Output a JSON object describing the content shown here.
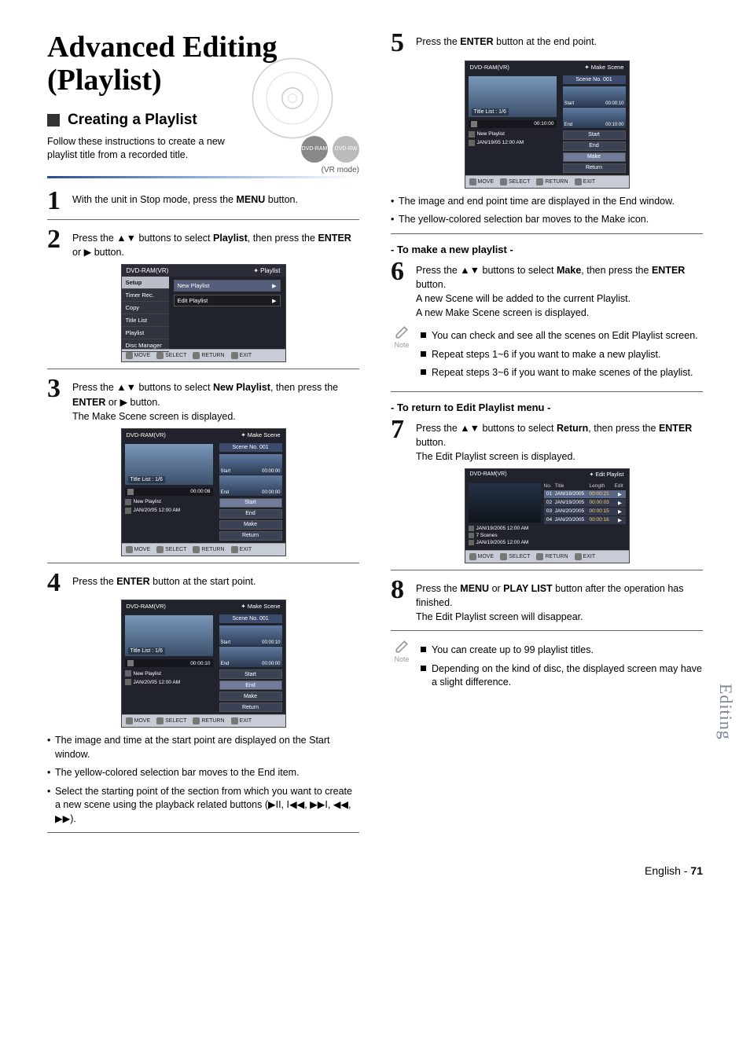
{
  "page": {
    "main_title_line1": "Advanced Editing",
    "main_title_line2": "(Playlist)",
    "section_title": "Creating a Playlist",
    "intro": "Follow these instructions to create a new playlist title from a recorded title.",
    "badge1": "DVD-RAM",
    "badge2": "DVD-RW",
    "vr_mode": "(VR mode)",
    "side_tab": "Editing",
    "footer_lang": "English",
    "footer_sep": " - ",
    "footer_page": "71"
  },
  "steps": {
    "s1": {
      "num": "1",
      "text_a": "With the unit in Stop mode, press the ",
      "text_b": "MENU",
      "text_c": " button."
    },
    "s2": {
      "num": "2",
      "a": "Press the ",
      "b": "▲▼",
      "c": " buttons to select ",
      "d": "Playlist",
      "e": ", then press the ",
      "f": "ENTER",
      "g": " or ",
      "h": "▶",
      "i": " button."
    },
    "s3": {
      "num": "3",
      "a": "Press the ",
      "b": "▲▼",
      "c": " buttons to select ",
      "d": "New Playlist",
      "e": ", then press the ",
      "f": "ENTER",
      "g": " or ",
      "h": "▶",
      "i": " button.",
      "sub": "The Make Scene screen is displayed."
    },
    "s4": {
      "num": "4",
      "a": "Press the ",
      "b": "ENTER",
      "c": " button at the start point."
    },
    "s4b": [
      "The image and time at the start point are displayed on the Start window.",
      "The yellow-colored selection bar moves to the End item.",
      "Select the starting point of the section from which you want to create a new scene using the playback related buttons (▶II, I◀◀, ▶▶I, ◀◀, ▶▶)."
    ],
    "s5": {
      "num": "5",
      "a": "Press the ",
      "b": "ENTER",
      "c": " button at the end point."
    },
    "s5b": [
      "The image and end point time are displayed in the End window.",
      "The yellow-colored selection bar moves to the Make icon."
    ],
    "s6": {
      "num": "6",
      "a": "Press the ",
      "b": "▲▼",
      "c": " buttons to select ",
      "d": "Make",
      "e": ", then press the ",
      "f": "ENTER",
      "g": " button.",
      "sub1": "A new Scene will be added to the current Playlist.",
      "sub2": "A new Make Scene screen is displayed."
    },
    "note1": [
      "You can check and see all the scenes on Edit Playlist screen.",
      "Repeat steps 1~6 if you want to make a new playlist.",
      "Repeat steps 3~6 if you want to make scenes of the playlist."
    ],
    "s7": {
      "num": "7",
      "a": "Press the ",
      "b": "▲▼",
      "c": " buttons to select ",
      "d": "Return",
      "e": ", then press the ",
      "f": "ENTER",
      "g": " button.",
      "sub": "The Edit Playlist screen is displayed."
    },
    "s8": {
      "num": "8",
      "a": "Press the ",
      "b": "MENU",
      "c": " or ",
      "d": "PLAY LIST",
      "e": " button after the operation has finished.",
      "sub": "The Edit Playlist screen will disappear."
    },
    "note2": [
      "You can create up to 99 playlist titles.",
      "Depending on the kind of disc, the displayed screen may have a slight difference."
    ],
    "sub_newpl": "- To make a new playlist -",
    "sub_return": "- To return to Edit Playlist menu -",
    "note_label": "Note"
  },
  "osd_menu": {
    "header_l": "DVD-RAM(VR)",
    "header_r": "Playlist",
    "side": [
      "Setup",
      "Timer Rec.",
      "Copy",
      "Title List",
      "Playlist",
      "Disc Manager"
    ],
    "opts": [
      "New Playlist",
      "Edit Playlist"
    ],
    "foot": {
      "move": "MOVE",
      "select": "SELECT",
      "return": "RETURN",
      "exit": "EXIT"
    }
  },
  "osd_scene": {
    "header_l": "DVD-RAM(VR)",
    "header_r": "Make Scene",
    "scene_no": "Scene No. 001",
    "title_cap": "Title List : 1/6",
    "tl_time": "00:00:08",
    "tl_time2": "00:00:10",
    "tl_time3": "00:10:00",
    "np": "New Playlist",
    "date1": "JAN/20/05 12:00 AM",
    "date2": "JAN/19/05 12:00 AM",
    "start": "Start",
    "end": "End",
    "make": "Make",
    "ret": "Return",
    "t_start": "00:00:00",
    "t_start2": "00:00:10",
    "t_end": "00:00:00",
    "t_end2": "00:10:00"
  },
  "osd_edit": {
    "header_l": "DVD-RAM(VR)",
    "header_r": "Edit Playlist",
    "meta1": "JAN/19/2005 12:00 AM",
    "meta2": "7 Scenes",
    "meta3": "JAN/19/2005 12:00 AM",
    "cols": {
      "no": "No.",
      "title": "Title",
      "len": "Length",
      "edit": "Edit"
    },
    "rows": [
      {
        "no": "01",
        "title": "JAN/19/2005",
        "len": "00:00:21"
      },
      {
        "no": "02",
        "title": "JAN/19/2005",
        "len": "00:00:03"
      },
      {
        "no": "03",
        "title": "JAN/20/2005",
        "len": "00:00:15"
      },
      {
        "no": "04",
        "title": "JAN/20/2005",
        "len": "00:00:16"
      }
    ]
  }
}
